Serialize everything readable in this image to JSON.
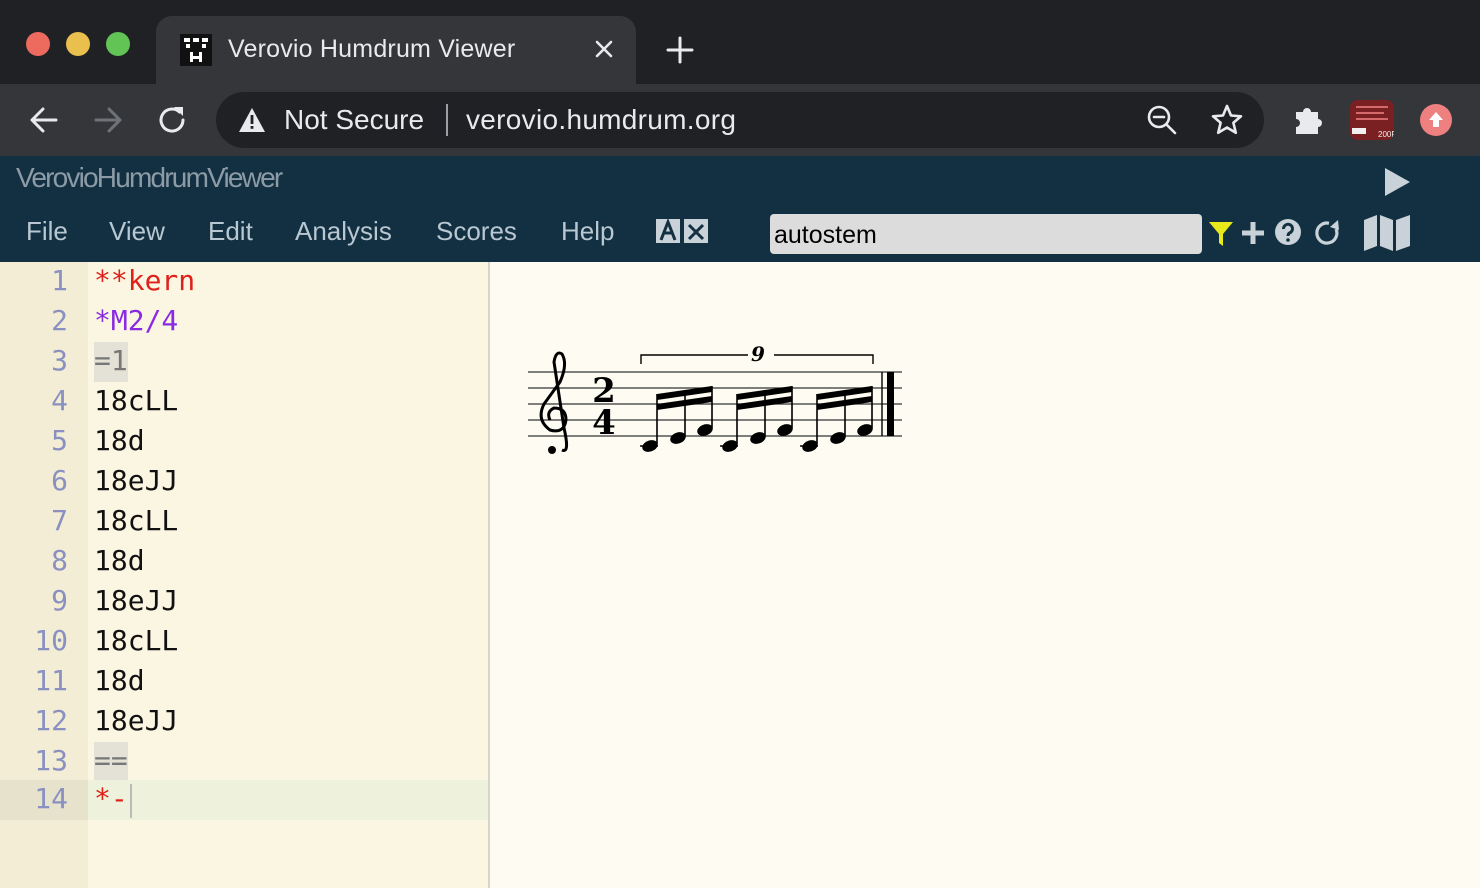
{
  "browser": {
    "tab_title": "Verovio Humdrum Viewer",
    "security_label": "Not Secure",
    "url": "verovio.humdrum.org",
    "profile_badge": "200F"
  },
  "app": {
    "title": "VerovioHumdrumViewer",
    "menu": [
      "File",
      "View",
      "Edit",
      "Analysis",
      "Scores",
      "Help"
    ],
    "filter_value": "autostem"
  },
  "editor": {
    "lines": [
      {
        "num": "1",
        "text": "**kern"
      },
      {
        "num": "2",
        "text": "*M2/4"
      },
      {
        "num": "3",
        "text": "=1"
      },
      {
        "num": "4",
        "text": "18cLL"
      },
      {
        "num": "5",
        "text": "18d"
      },
      {
        "num": "6",
        "text": "18eJJ"
      },
      {
        "num": "7",
        "text": "18cLL"
      },
      {
        "num": "8",
        "text": "18d"
      },
      {
        "num": "9",
        "text": "18eJJ"
      },
      {
        "num": "10",
        "text": "18cLL"
      },
      {
        "num": "11",
        "text": "18d"
      },
      {
        "num": "12",
        "text": "18eJJ"
      },
      {
        "num": "13",
        "text": "=="
      },
      {
        "num": "14",
        "text": "*-"
      }
    ]
  },
  "score": {
    "time_signature": {
      "top": "2",
      "bottom": "4"
    },
    "tuplet_number": "9"
  },
  "icons": {
    "back": "arrow-left-icon",
    "forward": "arrow-right-icon",
    "reload": "reload-icon",
    "zoom": "zoom-out-icon",
    "bookmark": "star-icon",
    "extensions": "puzzle-icon",
    "update": "arrow-up-circle-icon",
    "play": "play-icon",
    "filter": "filter-icon",
    "add": "plus-icon",
    "help": "help-icon",
    "refresh": "circle-arrow-icon",
    "map": "map-icon"
  }
}
